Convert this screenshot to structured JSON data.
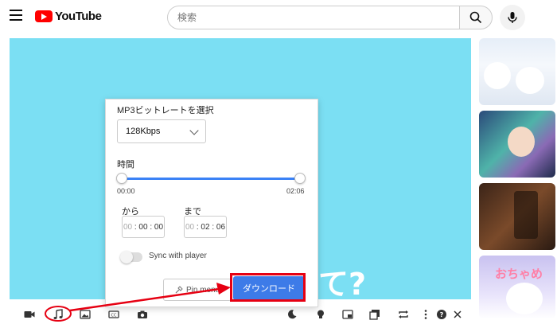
{
  "header": {
    "logo_text": "YouTube",
    "search_placeholder": "検索"
  },
  "video": {
    "overlay_text": "て?"
  },
  "sidebar": {
    "thumb4_text": "おちゃめ"
  },
  "panel": {
    "bitrate_label": "MP3ビットレートを選択",
    "bitrate_value": "128Kbps",
    "time_label": "時間",
    "slider_start": "00:00",
    "slider_end": "02:06",
    "from_label": "から",
    "to_label": "まで",
    "from_time": {
      "hours": "00",
      "rest": ": 00 : 00"
    },
    "to_time": {
      "hours": "00",
      "rest": ": 02 : 06"
    },
    "sync_label": "Sync with player",
    "pin_label": "Pin menu",
    "download_label": "ダウンロード"
  },
  "colors": {
    "video_bg": "#7bdff3",
    "download_btn": "#3d7be8",
    "annotation": "#e60012",
    "slider": "#3b82f6"
  }
}
